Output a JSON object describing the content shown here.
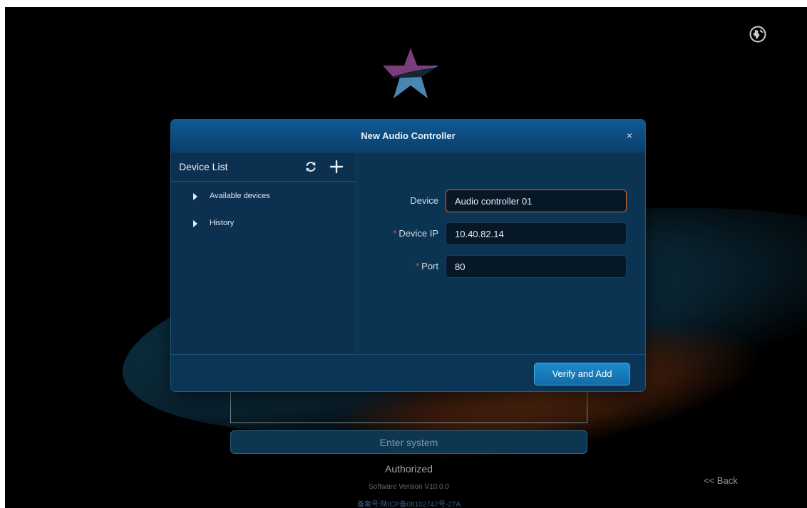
{
  "dialog": {
    "title": "New Audio Controller",
    "close_label": "×"
  },
  "device_list": {
    "title": "Device List",
    "items": [
      {
        "label": "Available devices"
      },
      {
        "label": "History"
      }
    ]
  },
  "form": {
    "device": {
      "label": "Device",
      "value": "Audio controller 01",
      "required": false
    },
    "device_ip": {
      "label": "Device IP",
      "value": "10.40.82.14",
      "required": true
    },
    "port": {
      "label": "Port",
      "value": "80",
      "required": true
    }
  },
  "footer": {
    "verify_label": "Verify and Add"
  },
  "background": {
    "enter_label": "Enter system",
    "authorized": "Authorized",
    "version": "Software Version V10.0.0",
    "icp": "备案号:陕ICP备08102747号-27A",
    "back_label": "<< Back"
  },
  "colors": {
    "accent": "#1d8bd0",
    "required": "#e0533d",
    "dialog_bg": "#0a2c48"
  },
  "icons": [
    "globe-icon",
    "logo-icon",
    "refresh-icon",
    "add-icon",
    "close-icon",
    "caret-right-icon"
  ]
}
